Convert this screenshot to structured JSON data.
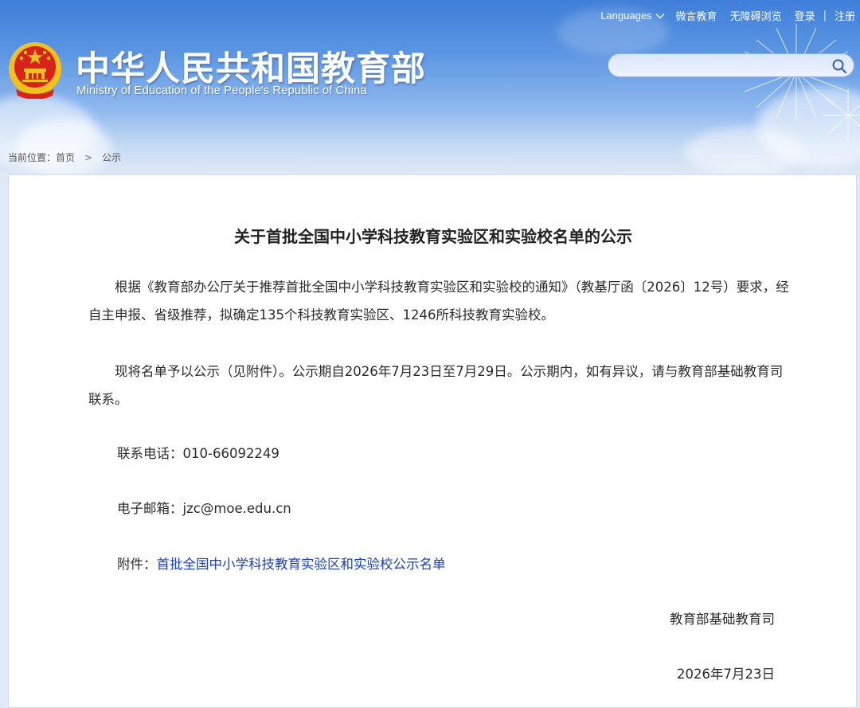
{
  "header": {
    "site_title": "中华人民共和国教育部",
    "site_subtitle": "Ministry of Education of the People's Republic of China",
    "emblem_icon": "national-emblem-icon",
    "nav": {
      "languages": "Languages",
      "weiyan": "微言教育",
      "accessible": "无障碍浏览",
      "login": "登录",
      "separator": "|",
      "register": "注册"
    },
    "search": {
      "placeholder": "",
      "icon": "search-icon"
    }
  },
  "breadcrumb": {
    "label": "当前位置：",
    "home": "首页",
    "arrow": ">",
    "current": "公示"
  },
  "article": {
    "title": "关于首批全国中小学科技教育实验区和实验校名单的公示",
    "paragraph1": "根据《教育部办公厅关于推荐首批全国中小学科技教育实验区和实验校的通知》（教基厅函〔2026〕12号）要求，经自主申报、省级推荐，拟确定135个科技教育实验区、1246所科技教育实验校。",
    "paragraph2": "现将名单予以公示（见附件）。公示期自2026年7月23日至7月29日。公示期内，如有异议，请与教育部基础教育司联系。",
    "phone_label": "联系电话：",
    "phone": "010-66092249",
    "email_label": "电子邮箱：",
    "email": "jzc@moe.edu.cn",
    "attachment_label": "附件：",
    "attachment_link": "首批全国中小学科技教育实验区和实验校公示名单",
    "signature": "教育部基础教育司",
    "date": "2026年7月23日"
  },
  "colors": {
    "header_top": "#3f7fd9",
    "link": "#1a3fbf",
    "emblem_red": "#d7231b",
    "emblem_gold": "#f2c11a"
  }
}
